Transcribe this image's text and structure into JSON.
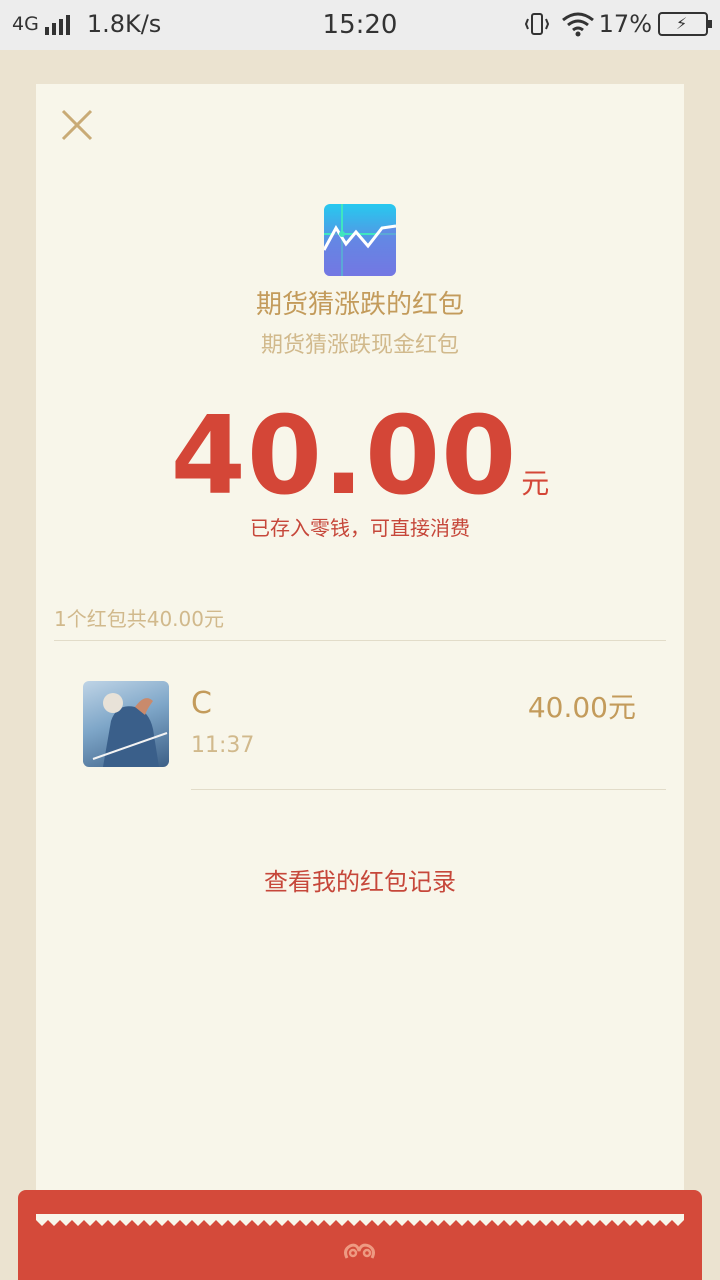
{
  "status_bar": {
    "network": "4G",
    "speed": "1.8K/s",
    "time": "15:20",
    "battery": "17%"
  },
  "redpacket": {
    "title": "期货猜涨跌的红包",
    "subtitle": "期货猜涨跌现金红包",
    "amount": "40.00",
    "unit": "元",
    "note": "已存入零钱，可直接消费",
    "summary": "1个红包共40.00元"
  },
  "recipients": [
    {
      "name": "C",
      "time": "11:37",
      "amount": "40.00元"
    }
  ],
  "links": {
    "records": "查看我的红包记录"
  },
  "colors": {
    "page_bg": "#ebe3d0",
    "card_bg": "#f8f6ea",
    "gold": "#c39b5b",
    "red": "#d44637"
  },
  "icons": {
    "close": "close-icon",
    "app": "chart-app-icon",
    "footer": "cloud-ornament-icon"
  }
}
